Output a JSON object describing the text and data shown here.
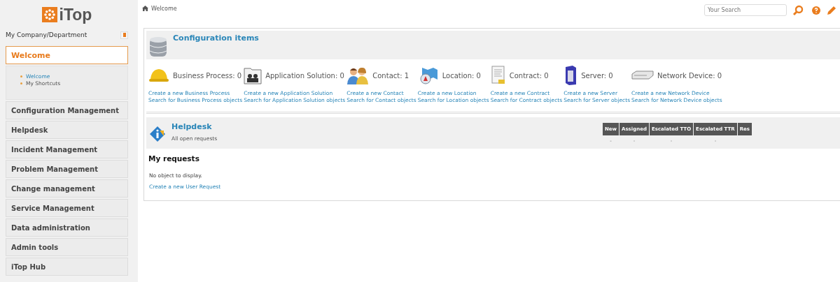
{
  "sidebar": {
    "logo": "iTop",
    "organization": "My Company/Department",
    "menus": [
      {
        "label": "Welcome",
        "expanded": true,
        "children": [
          {
            "label": "Welcome",
            "selected": true
          },
          {
            "label": "My Shortcuts",
            "selected": false
          }
        ]
      },
      {
        "label": "Configuration Management",
        "expanded": false
      },
      {
        "label": "Helpdesk",
        "expanded": false
      },
      {
        "label": "Incident Management",
        "expanded": false
      },
      {
        "label": "Problem Management",
        "expanded": false
      },
      {
        "label": "Change management",
        "expanded": false
      },
      {
        "label": "Service Management",
        "expanded": false
      },
      {
        "label": "Data administration",
        "expanded": false
      },
      {
        "label": "Admin tools",
        "expanded": false
      },
      {
        "label": "iTop Hub",
        "expanded": false
      }
    ]
  },
  "breadcrumb": "Welcome",
  "search": {
    "placeholder": "Your Search"
  },
  "configuration_items": {
    "title": "Configuration items",
    "items": [
      {
        "kind": "helmet",
        "label": "Business Process: 0",
        "create": "Create a new Business Process",
        "search": "Search for Business Process objects"
      },
      {
        "kind": "folder",
        "label": "Application Solution: 0",
        "create": "Create a new Application Solution",
        "search": "Search for Application Solution objects"
      },
      {
        "kind": "people",
        "label": "Contact: 1",
        "create": "Create a new Contact",
        "search": "Search for Contact objects"
      },
      {
        "kind": "map",
        "label": "Location: 0",
        "create": "Create a new Location",
        "search": "Search for Location objects"
      },
      {
        "kind": "document",
        "label": "Contract: 0",
        "create": "Create a new Contract",
        "search": "Search for Contract objects"
      },
      {
        "kind": "server",
        "label": "Server: 0",
        "create": "Create a new Server",
        "search": "Search for Server objects"
      },
      {
        "kind": "switch",
        "label": "Network Device: 0",
        "create": "Create a new Network Device",
        "search": "Search for Network Device objects"
      }
    ]
  },
  "helpdesk": {
    "title": "Helpdesk",
    "subtitle": "All open requests",
    "table": {
      "columns": [
        "New",
        "Assigned",
        "Escalated TTO",
        "Escalated TTR",
        "Res"
      ],
      "rows": [
        [
          "-",
          "-",
          "-",
          "-"
        ]
      ]
    },
    "my_requests": {
      "title": "My requests",
      "empty": "No object to display.",
      "create": "Create a new User Request"
    }
  }
}
